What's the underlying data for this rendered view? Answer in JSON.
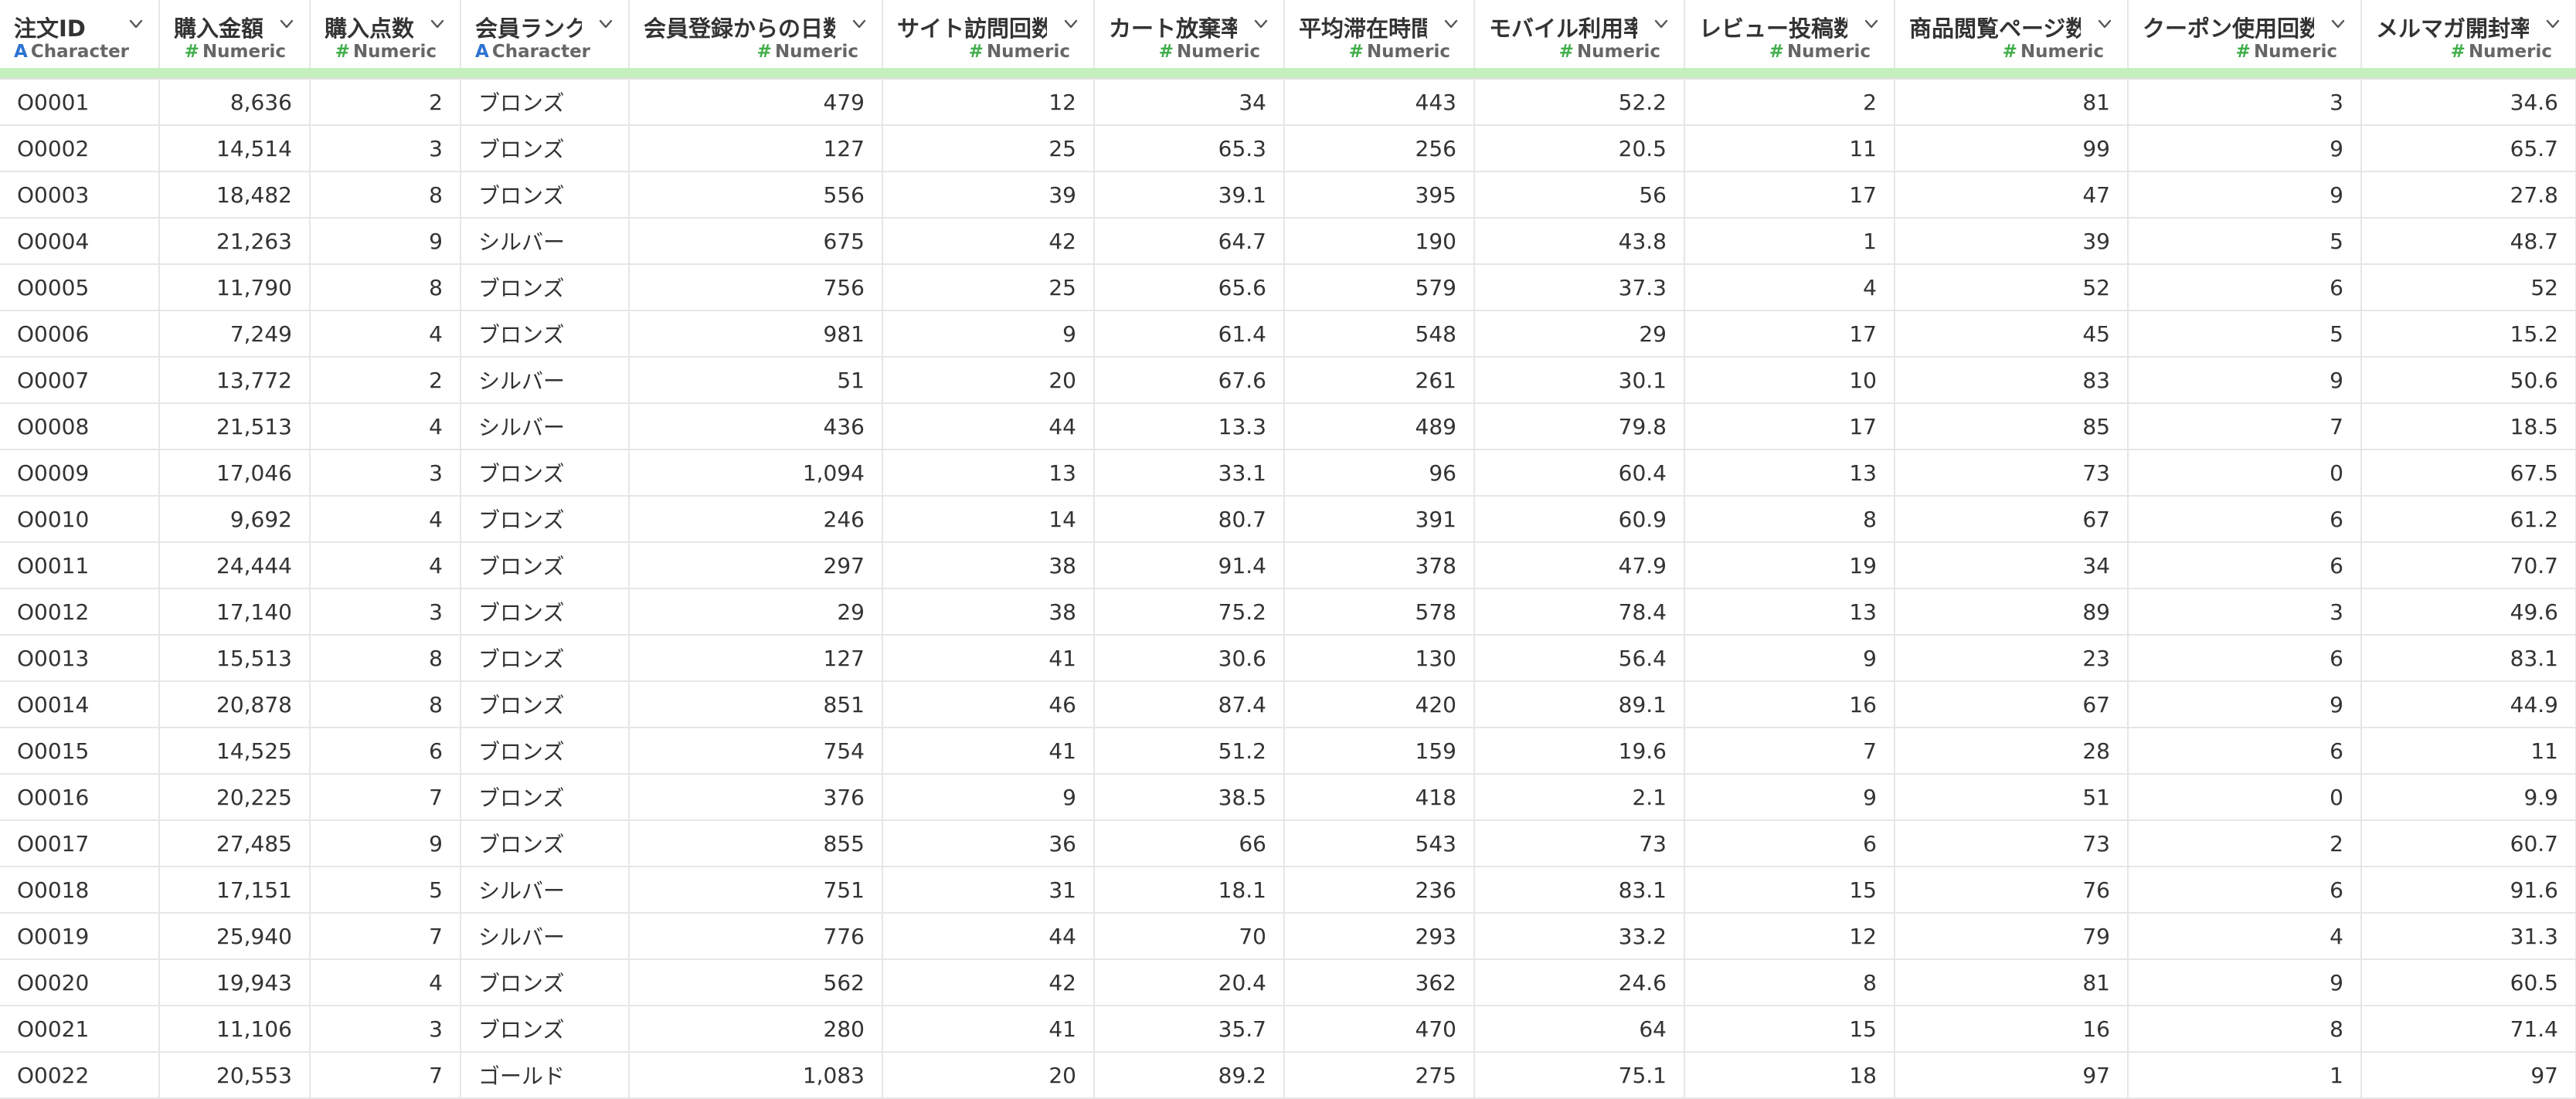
{
  "columns": [
    {
      "name": "注文ID",
      "type": "Character",
      "align": "left"
    },
    {
      "name": "購入金額",
      "type": "Numeric",
      "align": "right"
    },
    {
      "name": "購入点数",
      "type": "Numeric",
      "align": "right"
    },
    {
      "name": "会員ランク",
      "type": "Character",
      "align": "left"
    },
    {
      "name": "会員登録からの日数",
      "type": "Numeric",
      "align": "right"
    },
    {
      "name": "サイト訪問回数",
      "type": "Numeric",
      "align": "right"
    },
    {
      "name": "カート放棄率",
      "type": "Numeric",
      "align": "right"
    },
    {
      "name": "平均滞在時間",
      "type": "Numeric",
      "align": "right"
    },
    {
      "name": "モバイル利用率",
      "type": "Numeric",
      "align": "right"
    },
    {
      "name": "レビュー投稿数",
      "type": "Numeric",
      "align": "right"
    },
    {
      "name": "商品閲覧ページ数",
      "type": "Numeric",
      "align": "right"
    },
    {
      "name": "クーポン使用回数",
      "type": "Numeric",
      "align": "right"
    },
    {
      "name": "メルマガ開封率",
      "type": "Numeric",
      "align": "right"
    }
  ],
  "type_icons": {
    "Character": "A",
    "Numeric": "#"
  },
  "colors": {
    "numeric_icon": "#3fae49",
    "character_icon": "#2d73d2",
    "header_bar": "#c6efbe"
  },
  "rows": [
    [
      "O0001",
      "8,636",
      "2",
      "ブロンズ",
      "479",
      "12",
      "34",
      "443",
      "52.2",
      "2",
      "81",
      "3",
      "34.6"
    ],
    [
      "O0002",
      "14,514",
      "3",
      "ブロンズ",
      "127",
      "25",
      "65.3",
      "256",
      "20.5",
      "11",
      "99",
      "9",
      "65.7"
    ],
    [
      "O0003",
      "18,482",
      "8",
      "ブロンズ",
      "556",
      "39",
      "39.1",
      "395",
      "56",
      "17",
      "47",
      "9",
      "27.8"
    ],
    [
      "O0004",
      "21,263",
      "9",
      "シルバー",
      "675",
      "42",
      "64.7",
      "190",
      "43.8",
      "1",
      "39",
      "5",
      "48.7"
    ],
    [
      "O0005",
      "11,790",
      "8",
      "ブロンズ",
      "756",
      "25",
      "65.6",
      "579",
      "37.3",
      "4",
      "52",
      "6",
      "52"
    ],
    [
      "O0006",
      "7,249",
      "4",
      "ブロンズ",
      "981",
      "9",
      "61.4",
      "548",
      "29",
      "17",
      "45",
      "5",
      "15.2"
    ],
    [
      "O0007",
      "13,772",
      "2",
      "シルバー",
      "51",
      "20",
      "67.6",
      "261",
      "30.1",
      "10",
      "83",
      "9",
      "50.6"
    ],
    [
      "O0008",
      "21,513",
      "4",
      "シルバー",
      "436",
      "44",
      "13.3",
      "489",
      "79.8",
      "17",
      "85",
      "7",
      "18.5"
    ],
    [
      "O0009",
      "17,046",
      "3",
      "ブロンズ",
      "1,094",
      "13",
      "33.1",
      "96",
      "60.4",
      "13",
      "73",
      "0",
      "67.5"
    ],
    [
      "O0010",
      "9,692",
      "4",
      "ブロンズ",
      "246",
      "14",
      "80.7",
      "391",
      "60.9",
      "8",
      "67",
      "6",
      "61.2"
    ],
    [
      "O0011",
      "24,444",
      "4",
      "ブロンズ",
      "297",
      "38",
      "91.4",
      "378",
      "47.9",
      "19",
      "34",
      "6",
      "70.7"
    ],
    [
      "O0012",
      "17,140",
      "3",
      "ブロンズ",
      "29",
      "38",
      "75.2",
      "578",
      "78.4",
      "13",
      "89",
      "3",
      "49.6"
    ],
    [
      "O0013",
      "15,513",
      "8",
      "ブロンズ",
      "127",
      "41",
      "30.6",
      "130",
      "56.4",
      "9",
      "23",
      "6",
      "83.1"
    ],
    [
      "O0014",
      "20,878",
      "8",
      "ブロンズ",
      "851",
      "46",
      "87.4",
      "420",
      "89.1",
      "16",
      "67",
      "9",
      "44.9"
    ],
    [
      "O0015",
      "14,525",
      "6",
      "ブロンズ",
      "754",
      "41",
      "51.2",
      "159",
      "19.6",
      "7",
      "28",
      "6",
      "11"
    ],
    [
      "O0016",
      "20,225",
      "7",
      "ブロンズ",
      "376",
      "9",
      "38.5",
      "418",
      "2.1",
      "9",
      "51",
      "0",
      "9.9"
    ],
    [
      "O0017",
      "27,485",
      "9",
      "ブロンズ",
      "855",
      "36",
      "66",
      "543",
      "73",
      "6",
      "73",
      "2",
      "60.7"
    ],
    [
      "O0018",
      "17,151",
      "5",
      "シルバー",
      "751",
      "31",
      "18.1",
      "236",
      "83.1",
      "15",
      "76",
      "6",
      "91.6"
    ],
    [
      "O0019",
      "25,940",
      "7",
      "シルバー",
      "776",
      "44",
      "70",
      "293",
      "33.2",
      "12",
      "79",
      "4",
      "31.3"
    ],
    [
      "O0020",
      "19,943",
      "4",
      "ブロンズ",
      "562",
      "42",
      "20.4",
      "362",
      "24.6",
      "8",
      "81",
      "9",
      "60.5"
    ],
    [
      "O0021",
      "11,106",
      "3",
      "ブロンズ",
      "280",
      "41",
      "35.7",
      "470",
      "64",
      "15",
      "16",
      "8",
      "71.4"
    ],
    [
      "O0022",
      "20,553",
      "7",
      "ゴールド",
      "1,083",
      "20",
      "89.2",
      "275",
      "75.1",
      "18",
      "97",
      "1",
      "97"
    ]
  ]
}
